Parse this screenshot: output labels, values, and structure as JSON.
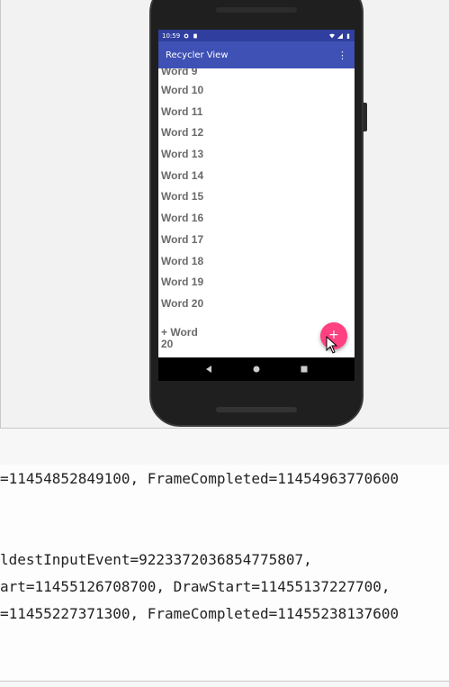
{
  "emulator": {
    "status_bar": {
      "time": "10:59"
    },
    "app_bar": {
      "title": "Recycler View",
      "menu_icon": "overflow-menu-icon"
    },
    "list_items": [
      "Word 9",
      "Word 10",
      "Word 11",
      "Word 12",
      "Word 13",
      "Word 14",
      "Word 15",
      "Word 16",
      "Word 17",
      "Word 18",
      "Word 19",
      "Word 20"
    ],
    "new_item": "+ Word\n20",
    "fab": {
      "label": "+",
      "color": "#ff4081"
    },
    "colors": {
      "primary": "#3f51b5",
      "primary_dark": "#303f9f",
      "accent": "#ff4081"
    }
  },
  "log": {
    "lines": [
      "=11454852849100, FrameCompleted=11454963770600",
      "ldestInputEvent=9223372036854775807,",
      "art=11455126708700, DrawStart=11455137227700,",
      "=11455227371300, FrameCompleted=11455238137600"
    ]
  }
}
